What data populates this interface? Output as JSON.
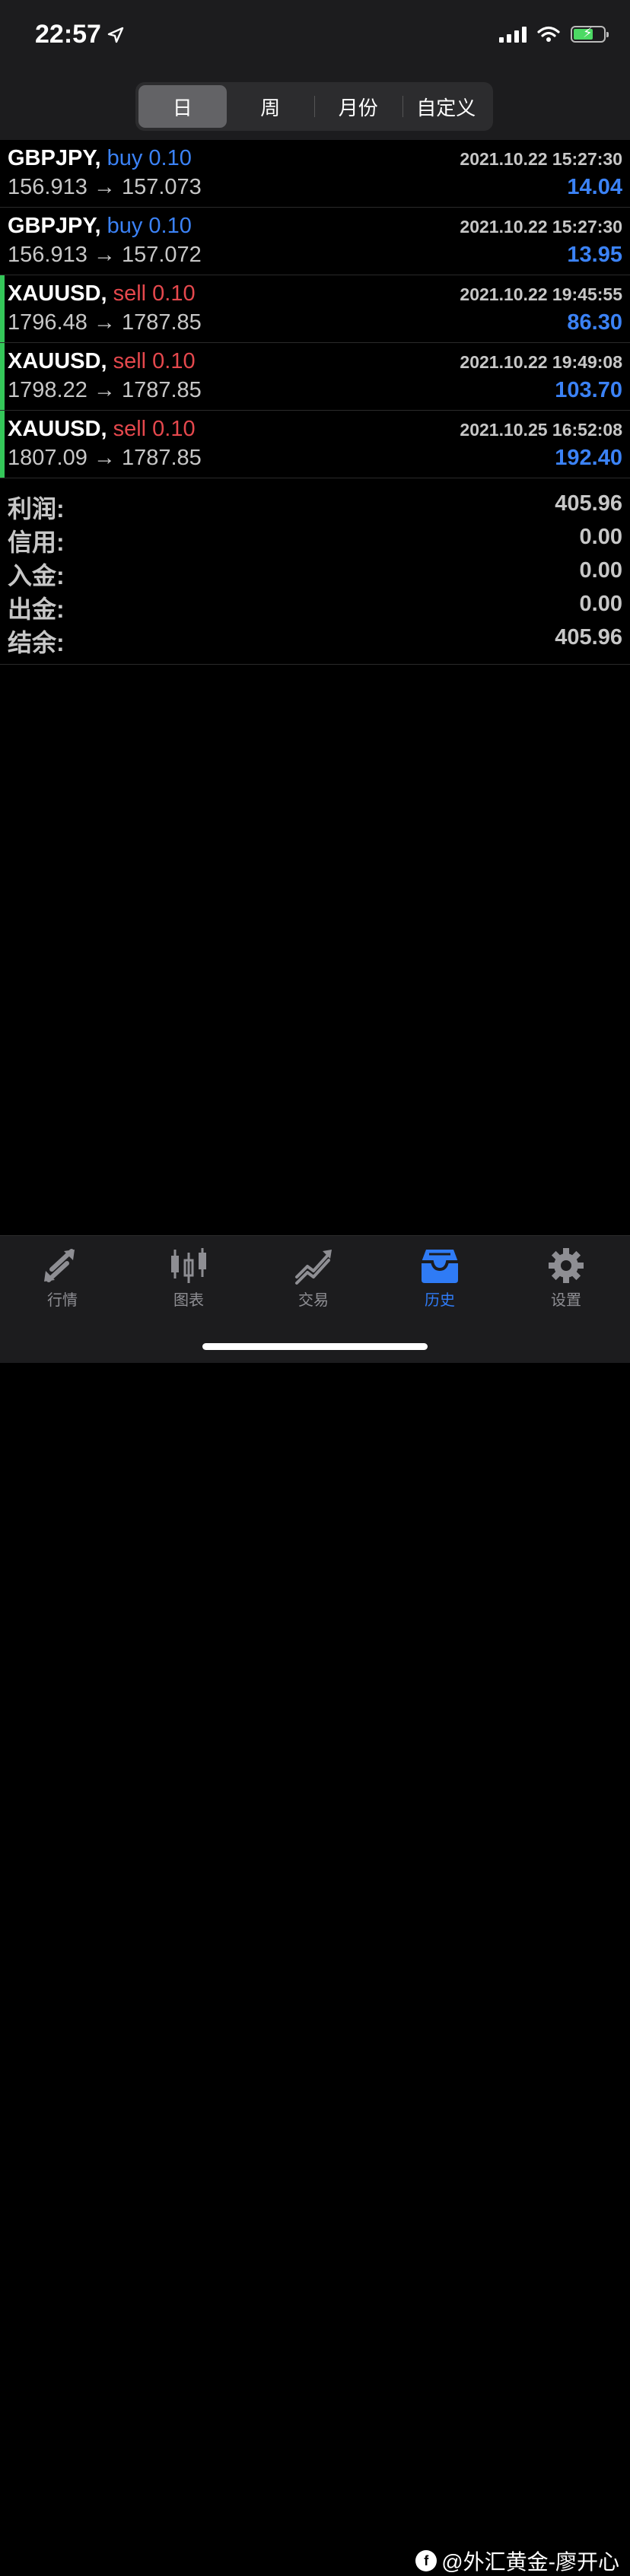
{
  "status_bar": {
    "time": "22:57"
  },
  "period_tabs": [
    {
      "label": "日",
      "active": true
    },
    {
      "label": "周",
      "active": false
    },
    {
      "label": "月份",
      "active": false
    },
    {
      "label": "自定义",
      "active": false
    }
  ],
  "trades": [
    {
      "symbol": "GBPJPY,",
      "side": "buy",
      "volume": "0.10",
      "open_price": "156.913",
      "close_price": "157.073",
      "datetime": "2021.10.22 15:27:30",
      "profit": "14.04",
      "bar": false
    },
    {
      "symbol": "GBPJPY,",
      "side": "buy",
      "volume": "0.10",
      "open_price": "156.913",
      "close_price": "157.072",
      "datetime": "2021.10.22 15:27:30",
      "profit": "13.95",
      "bar": false
    },
    {
      "symbol": "XAUUSD,",
      "side": "sell",
      "volume": "0.10",
      "open_price": "1796.48",
      "close_price": "1787.85",
      "datetime": "2021.10.22 19:45:55",
      "profit": "86.30",
      "bar": true
    },
    {
      "symbol": "XAUUSD,",
      "side": "sell",
      "volume": "0.10",
      "open_price": "1798.22",
      "close_price": "1787.85",
      "datetime": "2021.10.22 19:49:08",
      "profit": "103.70",
      "bar": true
    },
    {
      "symbol": "XAUUSD,",
      "side": "sell",
      "volume": "0.10",
      "open_price": "1807.09",
      "close_price": "1787.85",
      "datetime": "2021.10.25 16:52:08",
      "profit": "192.40",
      "bar": true
    }
  ],
  "arrow": "→",
  "summary": [
    {
      "label": "利润:",
      "value": "405.96"
    },
    {
      "label": "信用:",
      "value": "0.00"
    },
    {
      "label": "入金:",
      "value": "0.00"
    },
    {
      "label": "出金:",
      "value": "0.00"
    },
    {
      "label": "结余:",
      "value": "405.96"
    }
  ],
  "tabbar": [
    {
      "label": "行情",
      "icon": "quotes-arrows-icon",
      "active": false
    },
    {
      "label": "图表",
      "icon": "candlestick-chart-icon",
      "active": false
    },
    {
      "label": "交易",
      "icon": "trade-trend-icon",
      "active": false
    },
    {
      "label": "历史",
      "icon": "history-inbox-icon",
      "active": true
    },
    {
      "label": "设置",
      "icon": "gear-icon",
      "active": false
    }
  ],
  "watermark": {
    "text": "@外汇黄金-廖开心"
  },
  "colors": {
    "buy": "#3b82f6",
    "sell": "#e5484d",
    "profit": "#3b82f6",
    "bar": "#34c759",
    "active_tab": "#2f7bf5"
  }
}
